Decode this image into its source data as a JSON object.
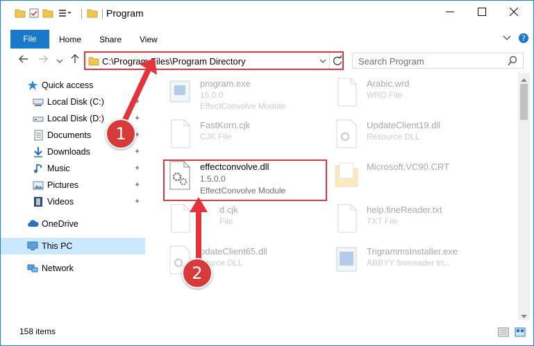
{
  "window": {
    "title": "Program",
    "colors": {
      "accent": "#1979ca",
      "highlight": "#e2343a",
      "selected": "#cce8ff"
    }
  },
  "ribbon": {
    "tabs": [
      {
        "label": "File"
      },
      {
        "label": "Home"
      },
      {
        "label": "Share"
      },
      {
        "label": "View"
      }
    ]
  },
  "address": {
    "path": "C:\\Program Files\\Program Directory",
    "search_placeholder": "Search Program"
  },
  "sidebar": {
    "items": [
      {
        "label": "Quick access",
        "icon": "star-icon"
      },
      {
        "label": "Local Disk (C:)",
        "icon": "drive-icon"
      },
      {
        "label": "Local Disk (D:)",
        "icon": "drive-icon"
      },
      {
        "label": "Documents",
        "icon": "documents-icon"
      },
      {
        "label": "Downloads",
        "icon": "download-icon"
      },
      {
        "label": "Music",
        "icon": "music-icon"
      },
      {
        "label": "Pictures",
        "icon": "pictures-icon"
      },
      {
        "label": "Videos",
        "icon": "videos-icon"
      },
      {
        "label": "OneDrive",
        "icon": "cloud-icon"
      },
      {
        "label": "This PC",
        "icon": "computer-icon"
      },
      {
        "label": "Network",
        "icon": "network-icon"
      }
    ]
  },
  "files": {
    "left": [
      {
        "name": "program.exe",
        "line1": "15.0.0",
        "line2": "EffectConvolve Module"
      },
      {
        "name": "FastKorn.cjk",
        "line1": "CJK File",
        "line2": ""
      },
      {
        "name": "effectconvolve.dll",
        "line1": "1.5.0.0",
        "line2": "EffectConvolve Module"
      },
      {
        "name": "d.cjk",
        "line1": "File",
        "line2": ""
      },
      {
        "name": "pdateClient65.dll",
        "line1": "source DLL",
        "line2": ""
      }
    ],
    "right": [
      {
        "name": "Arabic.wrd",
        "line1": "WRD File",
        "line2": ""
      },
      {
        "name": "UpdateClient19.dll",
        "line1": "Resource DLL",
        "line2": ""
      },
      {
        "name": "Microsoft.VC90.CRT",
        "line1": "",
        "line2": ""
      },
      {
        "name": "help.fineReader.txt",
        "line1": "TXT File",
        "line2": ""
      },
      {
        "name": "TrigrammsInstaller.exe",
        "line1": "ABBYY finereader tri...",
        "line2": ""
      }
    ]
  },
  "status": {
    "count": "158 items"
  },
  "callouts": {
    "one": "1",
    "two": "2"
  }
}
